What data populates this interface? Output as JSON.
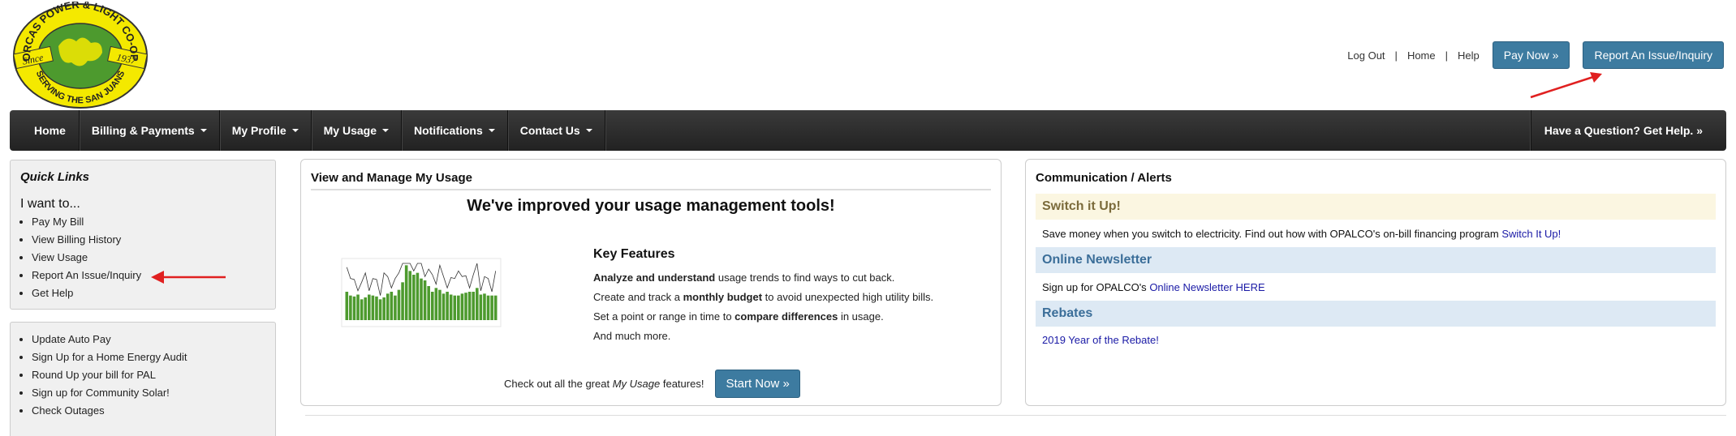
{
  "logo": {
    "arc_top": "ORCAS POWER & LIGHT CO-OP",
    "arc_bottom": "SERVING THE SAN JUANS",
    "since": "Since",
    "year": "1937"
  },
  "header": {
    "links": [
      {
        "label": "Log Out"
      },
      {
        "label": "Home"
      },
      {
        "label": "Help"
      }
    ],
    "pay_now": "Pay Now »",
    "report_issue": "Report An Issue/Inquiry"
  },
  "nav": {
    "items": [
      {
        "label": "Home",
        "dropdown": false
      },
      {
        "label": "Billing & Payments",
        "dropdown": true
      },
      {
        "label": "My Profile",
        "dropdown": true
      },
      {
        "label": "My Usage",
        "dropdown": true
      },
      {
        "label": "Notifications",
        "dropdown": true
      },
      {
        "label": "Contact Us",
        "dropdown": true
      }
    ],
    "help": "Have a Question? Get Help. »"
  },
  "quick_links": {
    "title": "Quick Links",
    "want_to": "I want to...",
    "items": [
      {
        "label": "Pay My Bill"
      },
      {
        "label": "View Billing History"
      },
      {
        "label": "View Usage"
      },
      {
        "label": "Report An Issue/Inquiry"
      },
      {
        "label": "Get Help"
      }
    ]
  },
  "more_links": {
    "items": [
      {
        "label": "Update Auto Pay"
      },
      {
        "label": "Sign Up for a Home Energy Audit"
      },
      {
        "label": "Round Up your bill for PAL"
      },
      {
        "label": "Sign up for Community Solar!"
      },
      {
        "label": "Check Outages"
      }
    ]
  },
  "usage": {
    "title": "View and Manage My Usage",
    "headline": "We've improved your usage management tools!",
    "key_features_title": "Key Features",
    "features": [
      {
        "bold_lead": "Analyze and understand",
        "after": " usage trends to find ways to cut back."
      },
      {
        "before": "Create and track a ",
        "bold": "monthly budget",
        "after": " to avoid unexpected high utility bills."
      },
      {
        "before": "Set a point or range in time to ",
        "bold": "compare differences",
        "after": " in usage."
      },
      {
        "before": "And much more."
      }
    ],
    "cta_before": "Check out all the great ",
    "cta_italic": "My Usage",
    "cta_after": " features!",
    "start_button": "Start Now »",
    "thumbnail_bars": [
      30,
      26,
      25,
      27,
      22,
      24,
      27,
      26,
      25,
      22,
      24,
      28,
      30,
      26,
      32,
      40,
      58,
      52,
      48,
      50,
      44,
      42,
      36,
      30,
      34,
      32,
      28,
      30,
      27,
      26,
      26,
      28,
      29,
      30,
      30,
      34,
      27,
      28,
      26,
      26,
      26
    ]
  },
  "comm": {
    "title": "Communication / Alerts",
    "alerts": [
      {
        "heading": "Switch it Up!",
        "text": "Save money when you switch to electricity. Find out how with OPALCO's on-bill financing program ",
        "link": "Switch It Up!"
      },
      {
        "heading": "Online Newsletter",
        "text": "Sign up for OPALCO's ",
        "link": "Online Newsletter HERE"
      },
      {
        "heading": "Rebates",
        "text": "",
        "link": "2019 Year of the Rebate!"
      }
    ]
  },
  "colors": {
    "button_blue": "#3d7ba0",
    "nav_dark": "#2a2a2a",
    "link_blue": "#1a1aa6",
    "arrow_red": "#e02020",
    "logo_yellow": "#f4e900",
    "logo_green": "#4d9a2e"
  }
}
